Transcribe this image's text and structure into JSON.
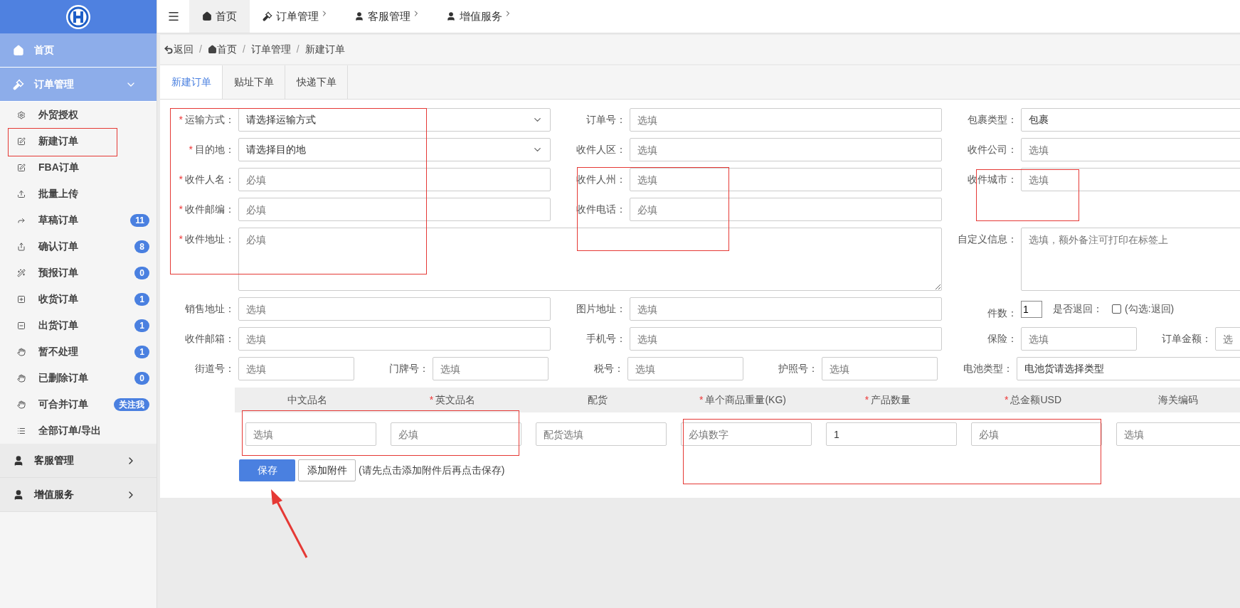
{
  "sidebar": {
    "sections": [
      {
        "label": "首页",
        "highlighted": true
      },
      {
        "label": "订单管理",
        "highlighted": true,
        "expanded": true,
        "children": [
          {
            "label": "外贸授权"
          },
          {
            "label": "新建订单"
          },
          {
            "label": "FBA订单"
          },
          {
            "label": "批量上传"
          },
          {
            "label": "草稿订单",
            "badge": "11"
          },
          {
            "label": "确认订单",
            "badge": "8"
          },
          {
            "label": "预报订单",
            "badge": "0"
          },
          {
            "label": "收货订单",
            "badge": "1"
          },
          {
            "label": "出货订单",
            "badge": "1"
          },
          {
            "label": "暂不处理",
            "badge": "1"
          },
          {
            "label": "已删除订单",
            "badge": "0"
          },
          {
            "label": "可合并订单",
            "badge": "关注我"
          },
          {
            "label": "全部订单/导出"
          }
        ]
      },
      {
        "label": "客服管理",
        "highlighted": false,
        "expanded": false
      },
      {
        "label": "增值服务",
        "highlighted": false,
        "expanded": false
      }
    ]
  },
  "top_nav": [
    {
      "label": "首页",
      "selected": true,
      "dropdown": false
    },
    {
      "label": "订单管理",
      "selected": false,
      "dropdown": true
    },
    {
      "label": "客服管理",
      "selected": false,
      "dropdown": true
    },
    {
      "label": "增值服务",
      "selected": false,
      "dropdown": true
    }
  ],
  "breadcrumb": {
    "separator": "/",
    "items": [
      "返回",
      "首页",
      "订单管理",
      "新建订单"
    ]
  },
  "tabs": [
    {
      "label": "新建订单",
      "selected": true
    },
    {
      "label": "贴址下单",
      "selected": false
    },
    {
      "label": "快递下单",
      "selected": false
    }
  ],
  "form": {
    "rows": [
      [
        [
          {
            "mark": "*",
            "label": "运输方式：",
            "kind": "select",
            "value": "请选择运输方式"
          }
        ],
        [
          {
            "label": "订单号：",
            "kind": "input",
            "placeholder": "选填"
          }
        ],
        [
          {
            "label": "包裹类型：",
            "kind": "input",
            "value": "包裹"
          }
        ]
      ],
      [
        [
          {
            "mark": "*",
            "label": "目的地：",
            "kind": "select",
            "value": "请选择目的地"
          }
        ],
        [
          {
            "label": "收件人区：",
            "kind": "input",
            "placeholder": "选填"
          }
        ],
        [
          {
            "label": "收件公司：",
            "kind": "input",
            "placeholder": "选填"
          }
        ]
      ],
      [
        [
          {
            "mark": "*",
            "label": "收件人名：",
            "kind": "input",
            "placeholder": "必填"
          }
        ],
        [
          {
            "label": "收件人州：",
            "kind": "input",
            "placeholder": "选填"
          }
        ],
        [
          {
            "label": "收件城市：",
            "kind": "input",
            "placeholder": "选填"
          }
        ]
      ],
      [
        [
          {
            "mark": "*",
            "label": "收件邮编：",
            "kind": "input",
            "placeholder": "必填"
          }
        ],
        [
          {
            "label": "收件电话：",
            "kind": "input",
            "placeholder": "必填"
          }
        ],
        []
      ],
      [
        [
          {
            "mark": "*",
            "label": "收件地址：",
            "kind": "wide_textarea",
            "placeholder": "必填"
          }
        ],
        [],
        [
          {
            "label": "自定义信息：",
            "kind": "textarea",
            "placeholder": "选填，额外备注可打印在标签上"
          }
        ]
      ],
      [
        [
          {
            "label": "销售地址：",
            "kind": "input",
            "placeholder": "选填"
          }
        ],
        [
          {
            "label": "图片地址：",
            "kind": "input",
            "placeholder": "选填"
          }
        ],
        [
          {
            "label": "件数：",
            "kind": "count",
            "value": "1"
          },
          {
            "label": "是否退回：",
            "kind": "checkbox",
            "checked": false,
            "text": "(勾选:退回)"
          }
        ]
      ],
      [
        [
          {
            "label": "收件邮箱：",
            "kind": "input",
            "placeholder": "选填"
          }
        ],
        [
          {
            "label": "手机号：",
            "kind": "input",
            "placeholder": "选填"
          }
        ],
        [
          {
            "label": "保险：",
            "kind": "input",
            "placeholder": "选填"
          },
          {
            "label": "订单金额：",
            "kind": "input",
            "placeholder": "选"
          }
        ]
      ],
      [
        [
          {
            "label": "街道号：",
            "kind": "input",
            "placeholder": "选填"
          },
          {
            "label": "门牌号：",
            "kind": "input",
            "placeholder": "选填"
          }
        ],
        [
          {
            "label": "税号：",
            "kind": "input",
            "placeholder": "选填"
          },
          {
            "label": "护照号：",
            "kind": "input",
            "placeholder": "选填"
          }
        ],
        [
          {
            "label": "电池类型：",
            "kind": "input",
            "value": "电池货请选择类型"
          }
        ]
      ]
    ]
  },
  "products": {
    "columns": [
      {
        "label": "中文品名"
      },
      {
        "mark": "*",
        "label": "英文品名"
      },
      {
        "label": "配货"
      },
      {
        "mark": "*",
        "label": "单个商品重量(KG)"
      },
      {
        "mark": "*",
        "label": "产品数量"
      },
      {
        "mark": "*",
        "label": "总金额USD"
      },
      {
        "label": "海关编码"
      }
    ],
    "row": [
      {
        "placeholder": "选填"
      },
      {
        "placeholder": "必填"
      },
      {
        "placeholder": "配货选填"
      },
      {
        "placeholder": "必填数字"
      },
      {
        "value": "1"
      },
      {
        "placeholder": "必填"
      },
      {
        "placeholder": "选填"
      }
    ]
  },
  "actions": {
    "save": "保存",
    "attach": "添加附件",
    "note": "(请先点击添加附件后再点击保存)"
  }
}
